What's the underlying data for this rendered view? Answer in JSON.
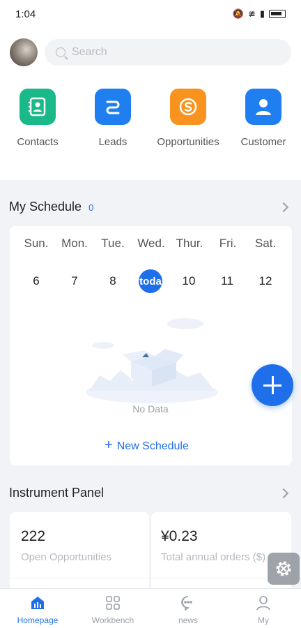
{
  "status_bar": {
    "time": "1:04"
  },
  "search": {
    "placeholder": "Search"
  },
  "quick_actions": [
    {
      "label": "Contacts",
      "icon": "contacts-book-icon",
      "color": "#19b98a"
    },
    {
      "label": "Leads",
      "icon": "leads-icon",
      "color": "#1f7ff0"
    },
    {
      "label": "Opportunities",
      "icon": "opportunity-coin-icon",
      "color": "#f7931e"
    },
    {
      "label": "Customer",
      "icon": "customer-person-icon",
      "color": "#1f7ff0"
    }
  ],
  "schedule": {
    "title": "My Schedule",
    "count": "0",
    "weekdays": [
      "Sun.",
      "Mon.",
      "Tue.",
      "Wed.",
      "Thur.",
      "Fri.",
      "Sat."
    ],
    "dates": [
      "6",
      "7",
      "8",
      "toda",
      "10",
      "11",
      "12"
    ],
    "empty_text": "No Data",
    "new_label": "New Schedule"
  },
  "panel": {
    "title": "Instrument Panel",
    "stats": [
      {
        "value": "222",
        "label": "Open Opportunities"
      },
      {
        "value": "¥0.23",
        "label": "Total annual orders ($)"
      }
    ]
  },
  "tabs": [
    {
      "label": "Homepage",
      "icon": "home-icon",
      "active": true
    },
    {
      "label": "Workbench",
      "icon": "grid-icon",
      "active": false
    },
    {
      "label": "news",
      "icon": "chat-bubble-icon",
      "active": false
    },
    {
      "label": "My",
      "icon": "user-icon",
      "active": false
    }
  ],
  "colors": {
    "accent": "#1f6feb",
    "background": "#f1f3f7"
  }
}
